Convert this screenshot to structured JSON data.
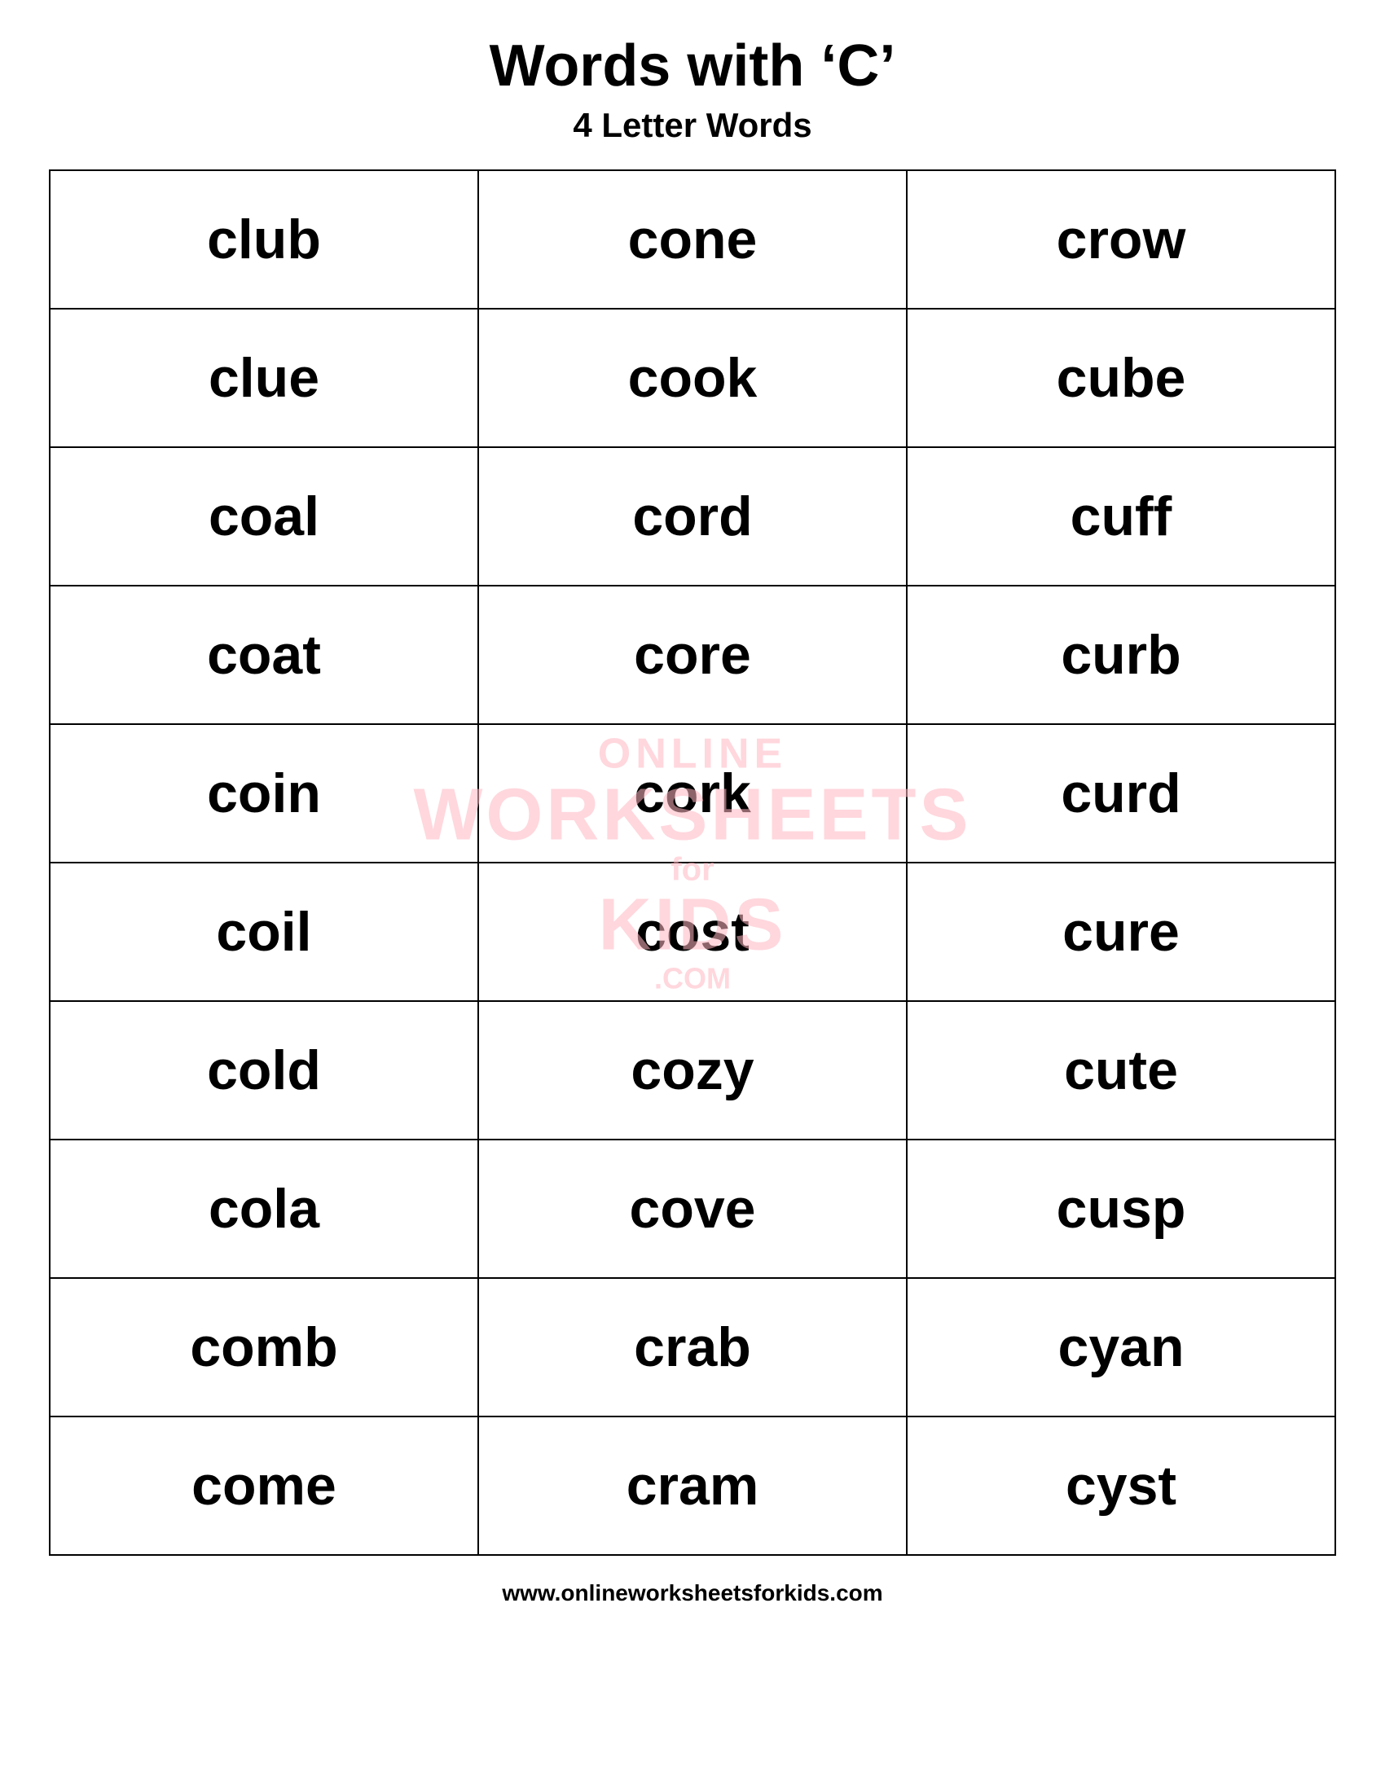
{
  "page": {
    "title": "Words with ‘C’",
    "subtitle": "4 Letter Words",
    "footer_url": "www.onlineworksheetsforkids.com"
  },
  "watermark": {
    "online": "ONLINE",
    "worksheets": "WORKSHEETS",
    "for": "for",
    "kids": "KIDS",
    "com": ".COM"
  },
  "rows": [
    [
      "club",
      "cone",
      "crow"
    ],
    [
      "clue",
      "cook",
      "cube"
    ],
    [
      "coal",
      "cord",
      "cuff"
    ],
    [
      "coat",
      "core",
      "curb"
    ],
    [
      "coin",
      "cork",
      "curd"
    ],
    [
      "coil",
      "cost",
      "cure"
    ],
    [
      "cold",
      "cozy",
      "cute"
    ],
    [
      "cola",
      "cove",
      "cusp"
    ],
    [
      "comb",
      "crab",
      "cyan"
    ],
    [
      "come",
      "cram",
      "cyst"
    ]
  ]
}
